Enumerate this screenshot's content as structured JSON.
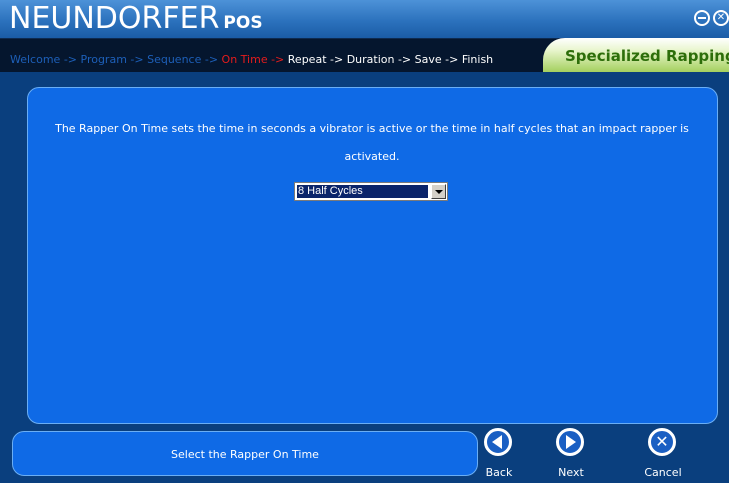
{
  "app": {
    "brand": "NEUNDORFER",
    "brand_suffix": "POS"
  },
  "window": {
    "minimize_icon": "minimize-icon",
    "close_icon": "close-icon"
  },
  "steps": [
    {
      "label": "Welcome -> ",
      "state": "done"
    },
    {
      "label": "Program -> ",
      "state": "done"
    },
    {
      "label": "Sequence -> ",
      "state": "done"
    },
    {
      "label": "On Time -> ",
      "state": "current"
    },
    {
      "label": "Repeat -> ",
      "state": "todo"
    },
    {
      "label": "Duration -> ",
      "state": "todo"
    },
    {
      "label": "Save -> ",
      "state": "todo"
    },
    {
      "label": "Finish",
      "state": "todo"
    }
  ],
  "mode_tab": {
    "label": "Specialized Rapping"
  },
  "main": {
    "description": "The Rapper On Time sets the time in seconds a vibrator is active or the time in half cycles that an impact rapper is activated.",
    "on_time_select": {
      "value": "8 Half Cycles"
    }
  },
  "status": {
    "message": "Select the Rapper On Time"
  },
  "nav": {
    "back_label": "Back",
    "next_label": "Next",
    "cancel_label": "Cancel"
  },
  "colors": {
    "step_done": "#1d5fb8",
    "step_current": "#e51c1c",
    "step_todo": "#ffffff",
    "panel": "#0f6ae6",
    "mode_tab_text": "#2d6e0a"
  }
}
